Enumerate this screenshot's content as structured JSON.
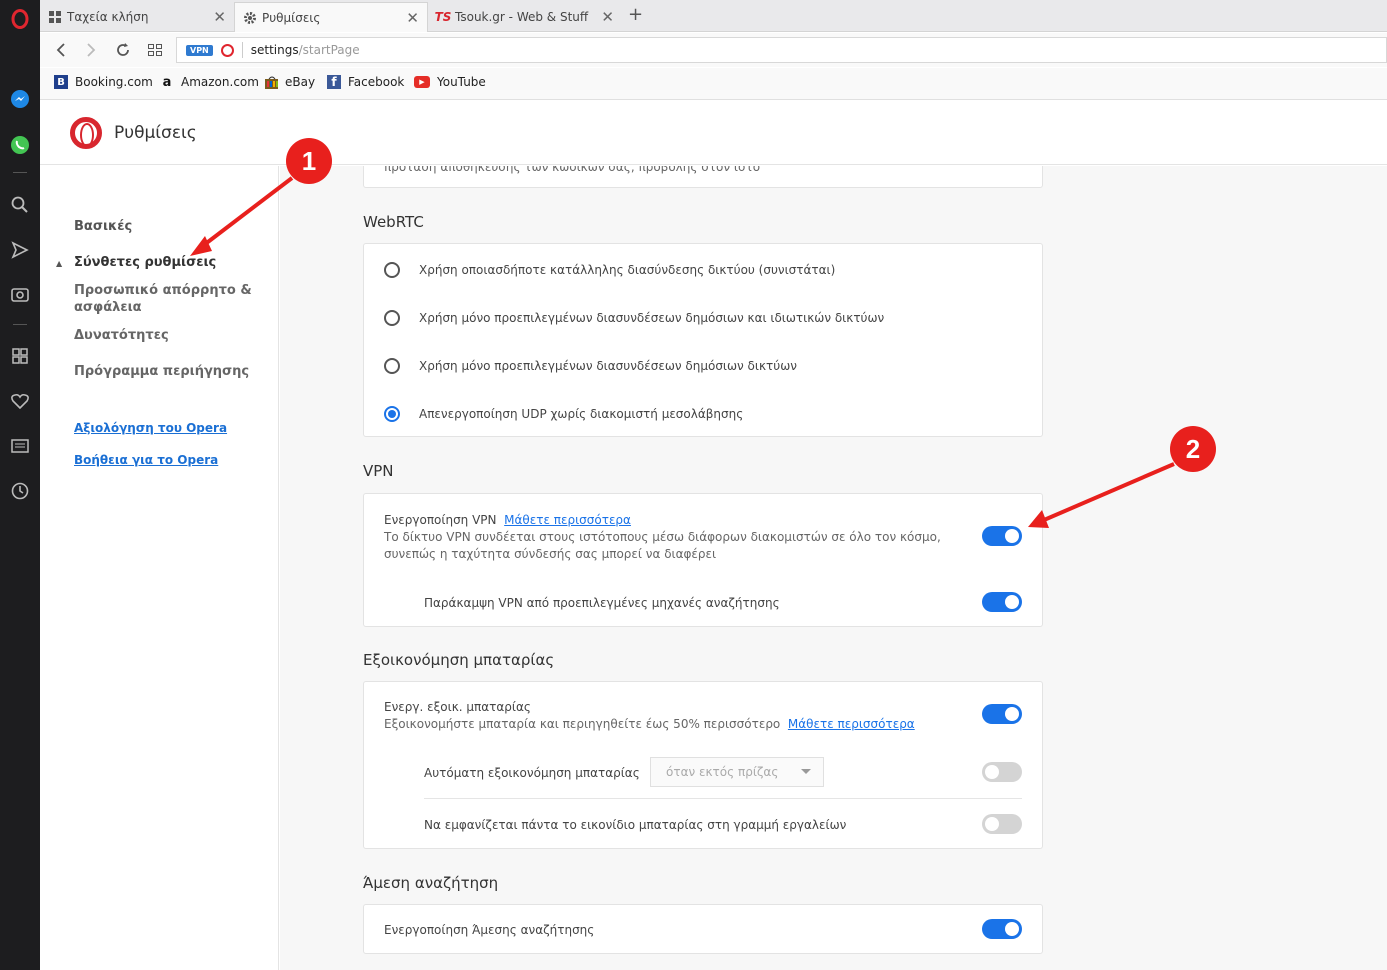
{
  "tabs": [
    {
      "label": "Ταχεία κλήση",
      "icon": "grid-icon"
    },
    {
      "label": "Ρυθμίσεις",
      "icon": "gear-icon"
    },
    {
      "label": "Tsouk.gr - Web & Stuff",
      "icon": "ts-logo-icon"
    }
  ],
  "address": {
    "vpn_badge": "VPN",
    "url_host": "settings",
    "url_path": "/startPage"
  },
  "bookmarks": [
    {
      "label": "Booking.com",
      "icon": "booking-icon",
      "glyph": "B",
      "color": "#1f3f8c"
    },
    {
      "label": "Amazon.com",
      "icon": "amazon-icon",
      "glyph": "a",
      "color": "#ffffff"
    },
    {
      "label": "eBay",
      "icon": "ebay-icon",
      "glyph": "",
      "color": "#7a5c1e"
    },
    {
      "label": "Facebook",
      "icon": "facebook-icon",
      "glyph": "f",
      "color": "#3b5998"
    },
    {
      "label": "YouTube",
      "icon": "youtube-icon",
      "glyph": "▶",
      "color": "#e52d27"
    }
  ],
  "header": {
    "title": "Ρυθμίσεις"
  },
  "sidebar": {
    "basic": "Βασικές",
    "advanced": "Σύνθετες ρυθμίσεις",
    "privacy_line1": "Προσωπικό απόρρητο &",
    "privacy_line2": "ασφάλεια",
    "features": "Δυνατότητες",
    "browser": "Πρόγραμμα περιήγησης",
    "rate_link": "Αξιολόγηση του Opera",
    "help_link": "Βοήθεια για το Opera"
  },
  "main": {
    "top_clipped": "πρόταση αποθήκευσης των κωδικών σας, προβολής στον ιστό",
    "webrtc": {
      "title": "WebRTC",
      "options": [
        {
          "label": "Χρήση οποιασδήποτε κατάλληλης διασύνδεσης δικτύου (συνιστάται)",
          "checked": false
        },
        {
          "label": "Χρήση μόνο προεπιλεγμένων διασυνδέσεων δημόσιων και ιδιωτικών δικτύων",
          "checked": false
        },
        {
          "label": "Χρήση μόνο προεπιλεγμένων διασυνδέσεων δημόσιων δικτύων",
          "checked": false
        },
        {
          "label": "Απενεργοποίηση UDP χωρίς διακομιστή μεσολάβησης",
          "checked": true
        }
      ]
    },
    "vpn": {
      "title": "VPN",
      "enable_label": "Ενεργοποίηση VPN",
      "learn_more": "Μάθετε περισσότερα",
      "desc_line1": "Το δίκτυο VPN συνδέεται στους ιστότοπους μέσω διάφορων διακομιστών σε όλο τον κόσμο,",
      "desc_line2": "συνεπώς η ταχύτητα σύνδεσής σας μπορεί να διαφέρει",
      "enable_on": true,
      "bypass_label": "Παράκαμψη VPN από προεπιλεγμένες μηχανές αναζήτησης",
      "bypass_on": true
    },
    "battery": {
      "title": "Εξοικονόμηση μπαταρίας",
      "enable_label": "Ενεργ. εξοικ. μπαταρίας",
      "desc": "Εξοικονομήστε μπαταρία και περιηγηθείτε έως 50% περισσότερο",
      "learn_more": "Μάθετε περισσότερα",
      "enable_on": true,
      "auto_label": "Αυτόματη εξοικονόμηση μπαταρίας",
      "auto_select": "όταν εκτός πρίζας",
      "auto_on": false,
      "icon_label": "Να εμφανίζεται πάντα το εικονίδιο μπαταρίας στη γραμμή εργαλείων",
      "icon_on": false
    },
    "instant": {
      "title": "Άμεση αναζήτηση",
      "enable_label": "Ενεργοποίηση Άμεσης αναζήτησης",
      "enable_on": true
    }
  },
  "annotations": [
    "1",
    "2"
  ],
  "colors": {
    "accent": "#1a73e8",
    "opera_red": "#d8262e",
    "annotation_red": "#e8201d"
  }
}
